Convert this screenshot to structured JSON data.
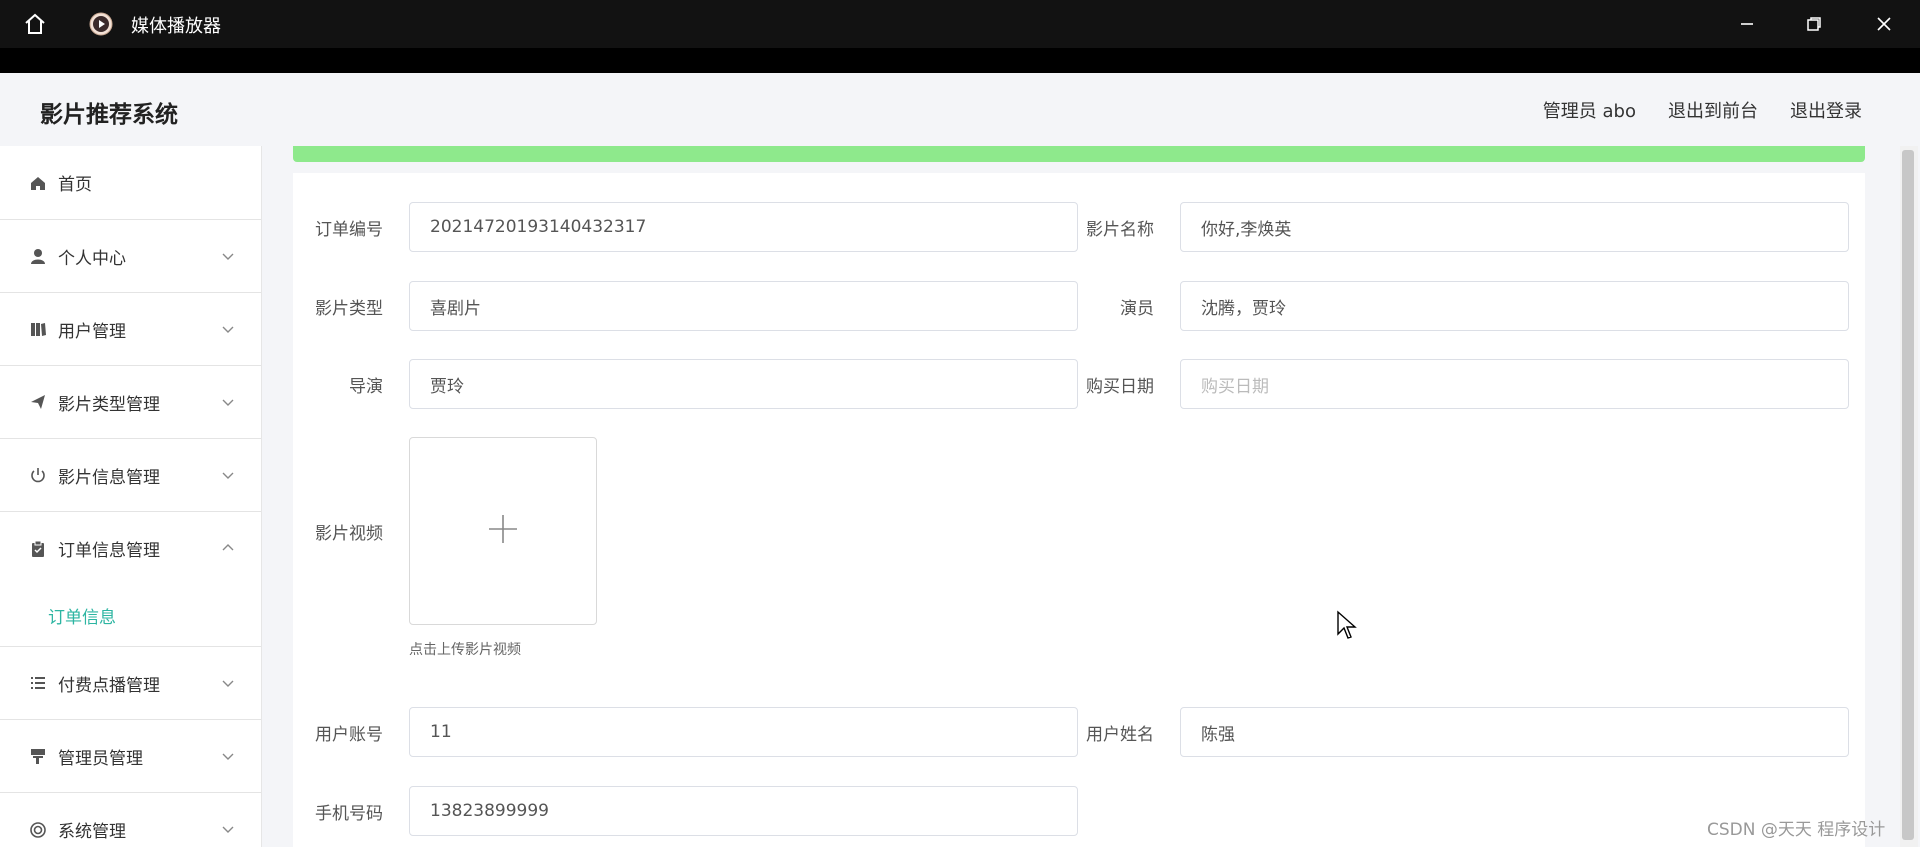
{
  "window": {
    "title": "媒体播放器",
    "icons": [
      "home-icon",
      "media-player-icon",
      "minimize-icon",
      "maximize-icon",
      "close-icon"
    ]
  },
  "header": {
    "brand": "影片推荐系统",
    "nav": {
      "admin": "管理员 abo",
      "frontend": "退出到前台",
      "logout": "退出登录"
    }
  },
  "sidebar": {
    "items": [
      {
        "label": "首页",
        "icon": "home-icon"
      },
      {
        "label": "个人中心",
        "icon": "user-icon"
      },
      {
        "label": "用户管理",
        "icon": "users-icon"
      },
      {
        "label": "影片类型管理",
        "icon": "send-icon"
      },
      {
        "label": "影片信息管理",
        "icon": "power-icon"
      },
      {
        "label": "订单信息管理",
        "icon": "clipboard-icon"
      },
      {
        "label": "付费点播管理",
        "icon": "list-icon"
      },
      {
        "label": "管理员管理",
        "icon": "stamp-icon"
      },
      {
        "label": "系统管理",
        "icon": "settings-icon"
      }
    ],
    "sub_item": "订单信息"
  },
  "form": {
    "order_no": {
      "label": "订单编号",
      "value": "2021472019314043231​7"
    },
    "film_name": {
      "label": "影片名称",
      "value": "你好,李焕英"
    },
    "film_type": {
      "label": "影片类型",
      "value": "喜剧片"
    },
    "actors": {
      "label": "演员",
      "value": "沈腾，贾玲"
    },
    "director": {
      "label": "导演",
      "value": "贾玲"
    },
    "purchase_date": {
      "label": "购买日期",
      "placeholder": "购买日期"
    },
    "video": {
      "label": "影片视频",
      "tip": "点击上传影片视频"
    },
    "account": {
      "label": "用户账号",
      "value": "11"
    },
    "user_name": {
      "label": "用户姓名",
      "value": "陈强"
    },
    "phone": {
      "label": "手机号码",
      "value": "13823899999"
    }
  },
  "watermark": "CSDN @天天 程序设计",
  "colors": {
    "accent": "#2db5a2",
    "greenbar": "#8ee98c",
    "titlebar": "#121212"
  }
}
